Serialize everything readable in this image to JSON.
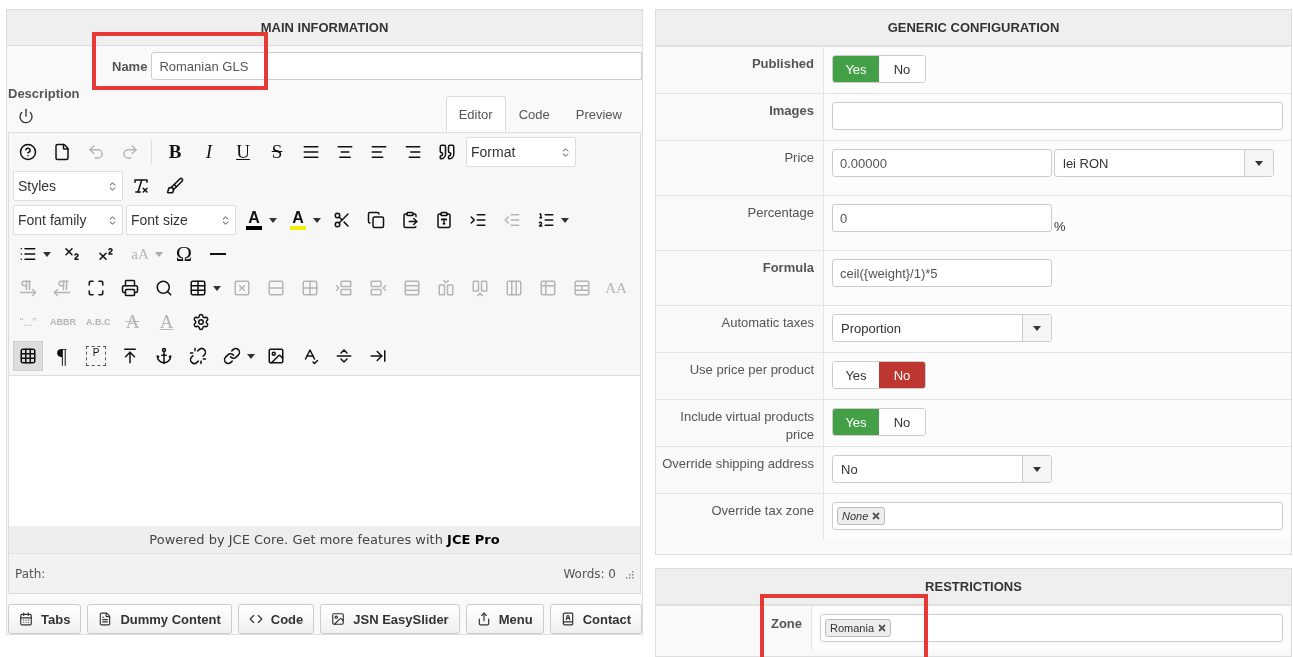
{
  "main": {
    "title": "MAIN INFORMATION",
    "name": {
      "label": "Name",
      "value": "Romanian GLS",
      "highlighted": true
    },
    "description": {
      "label": "Description",
      "tabs": [
        {
          "label": "Editor",
          "selected": true
        },
        {
          "label": "Code",
          "selected": false
        },
        {
          "label": "Preview",
          "selected": false
        }
      ],
      "toolbar": [
        [
          {
            "kind": "help",
            "disabled": false,
            "active": false
          },
          {
            "kind": "newdoc",
            "disabled": false,
            "active": false
          },
          {
            "kind": "undo",
            "disabled": true,
            "active": false
          },
          {
            "kind": "redo",
            "disabled": true,
            "active": false
          },
          {
            "kind": "sep"
          },
          {
            "kind": "bold",
            "text": "B",
            "disabled": false,
            "active": false
          },
          {
            "kind": "italic",
            "text": "I",
            "disabled": false,
            "active": false
          },
          {
            "kind": "underline",
            "text": "U",
            "disabled": false,
            "active": false
          },
          {
            "kind": "strike",
            "text": "S",
            "disabled": false,
            "active": false
          },
          {
            "kind": "justify",
            "disabled": false,
            "active": false
          },
          {
            "kind": "center",
            "disabled": false,
            "active": false
          },
          {
            "kind": "left",
            "disabled": false,
            "active": false
          },
          {
            "kind": "right",
            "disabled": false,
            "active": false
          },
          {
            "kind": "quote",
            "disabled": false,
            "active": false
          },
          {
            "kind": "select",
            "text": "Format"
          }
        ],
        [
          {
            "kind": "select",
            "text": "Styles"
          },
          {
            "kind": "clearformat",
            "disabled": false,
            "active": false
          },
          {
            "kind": "cleanup",
            "disabled": false,
            "active": false
          }
        ],
        [
          {
            "kind": "select",
            "text": "Font family"
          },
          {
            "kind": "select",
            "text": "Font size"
          },
          {
            "kind": "colorglyph",
            "text": "A",
            "color": "#000000",
            "disabled": false,
            "active": false
          },
          {
            "kind": "caret",
            "disabled": false
          },
          {
            "kind": "colorglyph",
            "text": "A",
            "color": "#f0f000",
            "disabled": false,
            "active": false
          },
          {
            "kind": "caret",
            "disabled": false
          },
          {
            "kind": "cut",
            "disabled": false,
            "active": false
          },
          {
            "kind": "copy",
            "disabled": false,
            "active": false
          },
          {
            "kind": "paste",
            "disabled": false,
            "active": false
          },
          {
            "kind": "pastetext",
            "disabled": false,
            "active": false
          },
          {
            "kind": "indent",
            "disabled": false,
            "active": false
          },
          {
            "kind": "outdent",
            "disabled": true,
            "active": false
          },
          {
            "kind": "numlist",
            "disabled": false,
            "active": false
          },
          {
            "kind": "caret",
            "disabled": false
          }
        ],
        [
          {
            "kind": "bullist",
            "disabled": false,
            "active": false
          },
          {
            "kind": "caret",
            "disabled": false
          },
          {
            "kind": "subscript",
            "disabled": false,
            "active": false
          },
          {
            "kind": "superscript",
            "disabled": false,
            "active": false
          },
          {
            "kind": "serif",
            "text": "aA",
            "disabled": true,
            "active": false
          },
          {
            "kind": "caret",
            "disabled": true
          },
          {
            "kind": "big",
            "text": "Ω",
            "disabled": false,
            "active": false
          },
          {
            "kind": "hr",
            "disabled": false,
            "active": false
          }
        ],
        [
          {
            "kind": "ltr",
            "disabled": true,
            "active": false
          },
          {
            "kind": "rtl",
            "disabled": true,
            "active": false
          },
          {
            "kind": "fullscreen",
            "disabled": false,
            "active": false
          },
          {
            "kind": "print",
            "disabled": false,
            "active": false
          },
          {
            "kind": "search",
            "disabled": false,
            "active": false
          },
          {
            "kind": "table",
            "disabled": false,
            "active": false
          },
          {
            "kind": "caret",
            "disabled": false
          },
          {
            "kind": "celldelete",
            "disabled": true,
            "active": false
          },
          {
            "kind": "rowprops",
            "disabled": true,
            "active": false
          },
          {
            "kind": "cellprops",
            "disabled": true,
            "active": false
          },
          {
            "kind": "rowbefore",
            "disabled": true,
            "active": false
          },
          {
            "kind": "rowafter",
            "disabled": true,
            "active": false
          },
          {
            "kind": "rowdelete",
            "disabled": true,
            "active": false
          },
          {
            "kind": "colbefore",
            "disabled": true,
            "active": false
          },
          {
            "kind": "colafter",
            "disabled": true,
            "active": false
          },
          {
            "kind": "coldelete",
            "disabled": true,
            "active": false
          },
          {
            "kind": "tabledelete",
            "disabled": true,
            "active": false
          },
          {
            "kind": "split",
            "disabled": true,
            "active": false
          },
          {
            "kind": "serif",
            "text": "AA",
            "disabled": true,
            "active": false
          }
        ],
        [
          {
            "kind": "small",
            "text": "“...”",
            "disabled": true,
            "active": false
          },
          {
            "kind": "tiny",
            "text": "ABBR",
            "disabled": true,
            "active": false
          },
          {
            "kind": "tiny",
            "text": "A.B.C",
            "disabled": true,
            "active": false
          },
          {
            "kind": "serifstrike",
            "text": "A",
            "disabled": true,
            "active": false
          },
          {
            "kind": "serifunder",
            "text": "A",
            "disabled": true,
            "active": false
          },
          {
            "kind": "settings",
            "disabled": false,
            "active": false
          }
        ],
        [
          {
            "kind": "visualaid",
            "disabled": false,
            "active": true
          },
          {
            "kind": "big",
            "text": "¶",
            "disabled": false,
            "active": false
          },
          {
            "kind": "dashedglyph",
            "text": "P",
            "disabled": false,
            "active": false
          },
          {
            "kind": "insert",
            "disabled": false,
            "active": false
          },
          {
            "kind": "anchor",
            "disabled": false,
            "active": false
          },
          {
            "kind": "unlink",
            "disabled": false,
            "active": false
          },
          {
            "kind": "link",
            "disabled": false,
            "active": false
          },
          {
            "kind": "caret",
            "disabled": false
          },
          {
            "kind": "image",
            "disabled": false,
            "active": false
          },
          {
            "kind": "spellcheck",
            "disabled": false,
            "active": false
          },
          {
            "kind": "pagebreak",
            "disabled": false,
            "active": false
          },
          {
            "kind": "readmore",
            "disabled": false,
            "active": false
          }
        ]
      ],
      "powered": "Powered by JCE Core. Get more features with **JCE Pro**",
      "path": "Path:",
      "words": "Words: 0"
    },
    "buttons": [
      {
        "label": "Tabs",
        "kind": "tabs"
      },
      {
        "label": "Dummy Content",
        "kind": "doc"
      },
      {
        "label": "Code",
        "kind": "code"
      },
      {
        "label": "JSN EasySlider",
        "kind": "image"
      },
      {
        "label": "Menu",
        "kind": "share"
      },
      {
        "label": "Contact",
        "kind": "contact"
      }
    ]
  },
  "config": {
    "title": "GENERIC CONFIGURATION",
    "rows": [
      {
        "label": "Published",
        "bold": true,
        "kind": "toggle",
        "options": [
          {
            "label": "Yes",
            "selected": true
          },
          {
            "label": "No",
            "selected": false
          }
        ]
      },
      {
        "label": "Images",
        "bold": true,
        "kind": "widetext",
        "value": ""
      },
      {
        "label": "Price",
        "bold": false,
        "kind": "price",
        "value": "0.00000",
        "select": "lei RON"
      },
      {
        "label": "Percentage",
        "bold": false,
        "kind": "percent",
        "value": "0",
        "suffix": "%"
      },
      {
        "label": "Formula",
        "bold": true,
        "kind": "text",
        "value": "ceil({weight}/1)*5"
      },
      {
        "label": "Automatic taxes",
        "bold": false,
        "kind": "select",
        "value": "Proportion"
      },
      {
        "label": "Use price per product",
        "bold": false,
        "kind": "toggle",
        "options": [
          {
            "label": "Yes",
            "selected": false
          },
          {
            "label": "No",
            "selected": true
          }
        ]
      },
      {
        "label": "Include virtual products price",
        "bold": false,
        "kind": "toggle",
        "options": [
          {
            "label": "Yes",
            "selected": true
          },
          {
            "label": "No",
            "selected": false
          }
        ]
      },
      {
        "label": "Override shipping address",
        "bold": false,
        "kind": "select",
        "value": "No"
      },
      {
        "label": "Override tax zone",
        "bold": false,
        "kind": "tags",
        "tags": [
          {
            "label": "None",
            "italic": true
          }
        ]
      }
    ]
  },
  "restrictions": {
    "title": "RESTRICTIONS",
    "zone": {
      "label": "Zone",
      "tags": [
        {
          "label": "Romania",
          "italic": false
        }
      ],
      "highlighted": true
    }
  }
}
